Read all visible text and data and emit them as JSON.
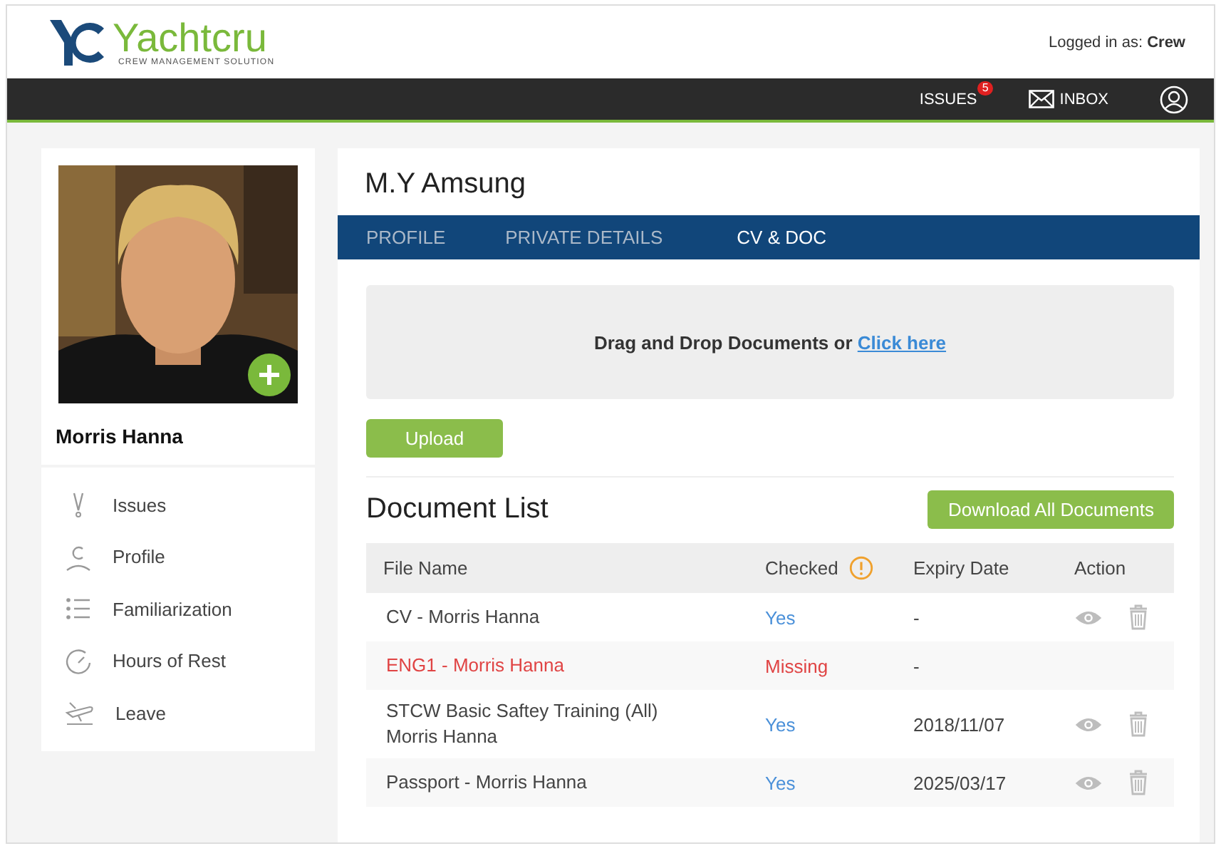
{
  "logo": {
    "name": "Yachtcru",
    "tagline": "CREW MANAGEMENT SOLUTION"
  },
  "user": {
    "label": "Logged in as:",
    "name": "Crew"
  },
  "nav": [
    {
      "kind": "issues",
      "label": "ISSUES",
      "badge": "5"
    },
    {
      "kind": "inbox",
      "label": "INBOX"
    },
    {
      "kind": "account"
    }
  ],
  "profile": {
    "name": "Morris Hanna"
  },
  "sidebar": {
    "items": [
      {
        "kind": "issues",
        "label": "Issues"
      },
      {
        "kind": "profile",
        "label": "Profile"
      },
      {
        "kind": "list",
        "label": "Familiarization"
      },
      {
        "kind": "clock",
        "label": "Hours of Rest"
      },
      {
        "kind": "plane",
        "label": "Leave"
      }
    ]
  },
  "vessel": "M.Y Amsung",
  "tabs": [
    {
      "label": "PROFILE",
      "selected": false
    },
    {
      "label": "PRIVATE DETAILS",
      "selected": false
    },
    {
      "label": "CV & DOC",
      "selected": true
    }
  ],
  "dropzone": {
    "text": "Drag and Drop Documents or",
    "link": "Click here"
  },
  "upload_button": "Upload",
  "document_list": {
    "title": "Document List",
    "download_button": "Download All Documents"
  },
  "table": {
    "columns": [
      {
        "label": "File Name",
        "info": false
      },
      {
        "label": "Checked",
        "info": true
      },
      {
        "label": "Expiry Date",
        "info": false
      },
      {
        "label": "Action",
        "info": false
      }
    ],
    "rows": [
      {
        "file": "CV -  Morris Hanna",
        "checked": "Yes",
        "expiry": "-",
        "missing": false,
        "actions": true
      },
      {
        "file": "ENG1 - Morris Hanna",
        "checked": "Missing",
        "expiry": "-",
        "missing": true,
        "actions": false
      },
      {
        "file": "STCW Basic Saftey Training (All)\nMorris Hanna",
        "checked": "Yes",
        "expiry": "2018/11/07",
        "missing": false,
        "actions": true
      },
      {
        "file": "Passport - Morris Hanna",
        "checked": "Yes",
        "expiry": "2025/03/17",
        "missing": false,
        "actions": true
      }
    ]
  }
}
